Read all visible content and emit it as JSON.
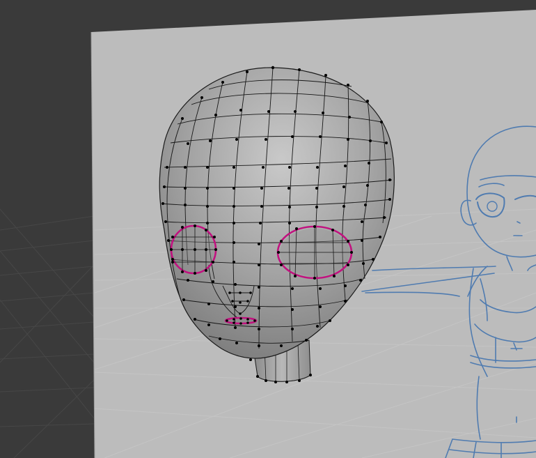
{
  "viewport": {
    "mode": "edit-mode-wireframe",
    "background_color": "#3a3a3a",
    "grid_line_color": "#4a4a4a",
    "reference_plane_color": "#bdbdbd",
    "reference_sketch_color": "#4f7bb0"
  },
  "mesh": {
    "name": "head",
    "face_color": "#9c9c9c",
    "edge_color": "#111111",
    "vertex_color": "#000000",
    "selected_edge_color": "#c1127f",
    "selected_loops": [
      "left-eye-loop",
      "right-eye-loop",
      "mouth-loop"
    ]
  },
  "icons": [
    "reference-image-icon",
    "mesh-head-icon",
    "vertex-icon"
  ]
}
